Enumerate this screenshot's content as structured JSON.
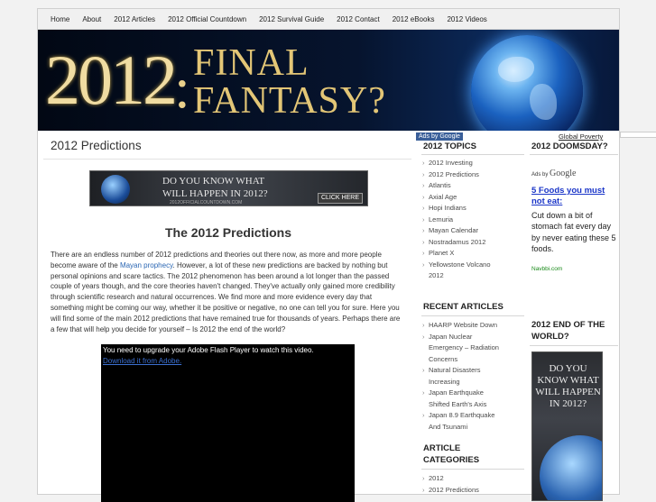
{
  "nav": {
    "items": [
      "Home",
      "About",
      "2012 Articles",
      "2012 Official Countdown",
      "2012 Survival Guide",
      "2012 Contact",
      "2012 eBooks",
      "2012 Videos"
    ]
  },
  "banner": {
    "big_year": "2012",
    "colon": ":",
    "line1": "FINAL",
    "line2": "FANTASY?"
  },
  "main": {
    "page_title": "2012 Predictions",
    "ad_banner": {
      "line1": "DO YOU KNOW WHAT",
      "line2": "WILL HAPPEN IN 2012?",
      "url": "2012OFFICIALCOUNTDOWN.COM",
      "button": "CLICK HERE"
    },
    "article_heading": "The 2012 Predictions",
    "article_before_link": "There are an endless number of 2012 predictions and theories out there now, as more and more people become aware of the ",
    "article_link": "Mayan prophecy",
    "article_after_link": ". However, a lot of these new predictions are backed by nothing but personal opinions and scare tactics. The 2012 phenomenon has been around a lot longer than the passed couple of years though, and the core theories haven't changed. They've actually only gained more credibility through scientific research and natural occurrences. We find more and more evidence every day that something might be coming our way, whether it be positive or negative, no one can tell you for sure. Here you will find some of the main 2012 predictions that have remained true for thousands of years. Perhaps there are a few that will help you decide for yourself – Is 2012 the end of the world?",
    "video": {
      "message": "You need to upgrade your Adobe Flash Player to watch this video.",
      "link": "Download it from Adobe."
    }
  },
  "sidebar1": {
    "ads_label": "Ads by Google",
    "topics_heading": "2012 TOPICS",
    "topics": [
      "2012 Investing",
      "2012 Predictions",
      "Atlantis",
      "Axial Age",
      "Hopi Indians",
      "Lemuria",
      "Mayan Calendar",
      "Nostradamus 2012",
      "Planet X",
      "Yellowstone Volcano"
    ],
    "topics_cont": "2012",
    "recent_heading": "RECENT ARTICLES",
    "recent": [
      {
        "line": "HAARP Website Down",
        "cont": []
      },
      {
        "line": "Japan Nuclear",
        "cont": [
          "Emergency – Radiation",
          "Concerns"
        ]
      },
      {
        "line": "Natural Disasters",
        "cont": [
          "Increasing"
        ]
      },
      {
        "line": "Japan Earthquake",
        "cont": [
          "Shifted Earth's Axis"
        ]
      },
      {
        "line": "Japan 8.9 Earthquake",
        "cont": [
          "And Tsunami"
        ]
      }
    ],
    "categories_heading_1": "ARTICLE",
    "categories_heading_2": "CATEGORIES",
    "categories": [
      "2012",
      "2012 Predictions"
    ]
  },
  "sidebar2": {
    "global_poverty": "Global Poverty",
    "doomsday_heading": "2012 DOOMSDAY?",
    "ads_prefix": "Ads by",
    "ads_brand": "Google",
    "ad_title": "5 Foods you must not eat:",
    "ad_text": "Cut down a bit of stomach fat every day by never eating these 5 foods.",
    "ad_url": "Navbbi.com",
    "end_heading_1": "2012 END OF THE",
    "end_heading_2": "WORLD?",
    "skyscraper_text": "DO YOU KNOW WHAT WILL HAPPEN IN 2012?"
  },
  "colors": {
    "link": "#2a66b3",
    "ad_title": "#1a35c8",
    "ads_badge": "#3a5f99",
    "ad_url": "#1a8a1a"
  }
}
